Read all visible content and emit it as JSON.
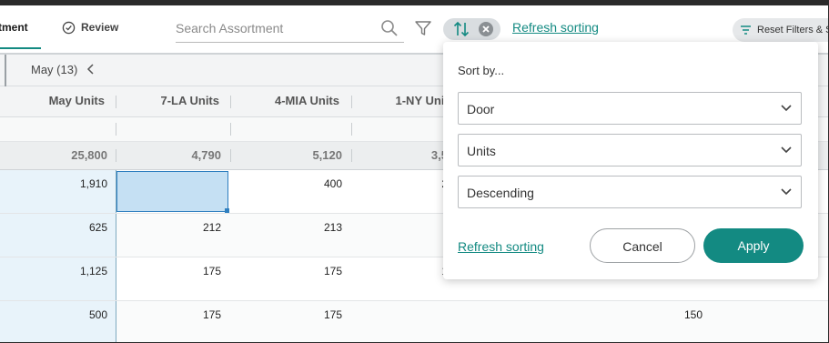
{
  "toolbar": {
    "tab_assortment": "tment",
    "tab_review": "Review",
    "search_placeholder": "Search Assortment",
    "refresh_sorting": "Refresh sorting",
    "reset_filters": "Reset Filters & S"
  },
  "grid": {
    "month_group": "May (13)",
    "columns": [
      "May Units",
      "7-LA Units",
      "4-MIA Units",
      "1-NY Units"
    ],
    "totals": [
      "25,800",
      "4,790",
      "5,120",
      "3,5"
    ],
    "rows": [
      {
        "may": "1,910",
        "la": "",
        "mia": "400",
        "ny": "2",
        "other": ""
      },
      {
        "may": "625",
        "la": "212",
        "mia": "213",
        "ny": "",
        "other": ""
      },
      {
        "may": "1,125",
        "la": "175",
        "mia": "175",
        "ny": "1",
        "other": ""
      },
      {
        "may": "500",
        "la": "175",
        "mia": "175",
        "ny": "",
        "other": "150"
      }
    ]
  },
  "sort_popover": {
    "title": "Sort by...",
    "field_1": "Door",
    "field_2": "Units",
    "field_3": "Descending",
    "refresh_sorting": "Refresh sorting",
    "cancel": "Cancel",
    "apply": "Apply"
  },
  "colors": {
    "accent": "#138a82",
    "selection": "#c5e0f3",
    "first_column": "#e8f3fa"
  }
}
